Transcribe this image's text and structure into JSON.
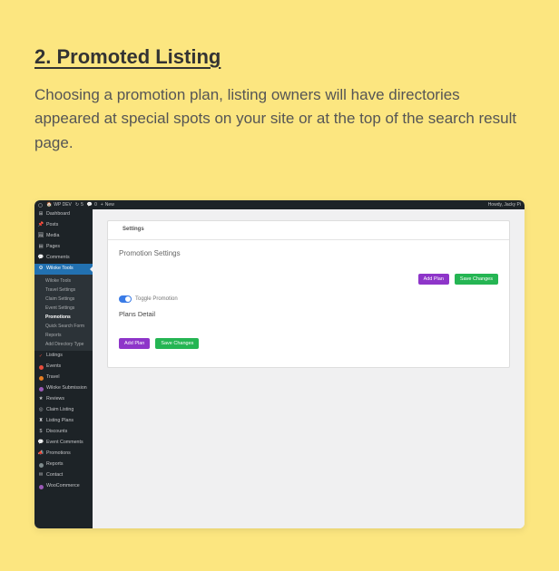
{
  "article": {
    "heading": "2. Promoted Listing",
    "description": "Choosing a promotion plan, listing owners will have directories appeared at special spots on your site or at the top of the search result page."
  },
  "wp": {
    "adminbar": {
      "site": "WP DEV",
      "updates": "5",
      "comments": "0",
      "new": "New",
      "greeting": "Howdy, Jacky Pi"
    },
    "menu": {
      "dashboard": "Dashboard",
      "posts": "Posts",
      "media": "Media",
      "pages": "Pages",
      "comments": "Comments",
      "wiloke_tools": "Wiloke Tools",
      "submenu": {
        "wiloke_tools": "Wiloke Tools",
        "travel_settings": "Travel Settings",
        "claim_settings": "Claim Settings",
        "event_settings": "Event Settings",
        "promotions": "Promotions",
        "quick_search": "Quick Search Form",
        "reports": "Reports",
        "add_directory": "Add Directory Type"
      },
      "listings": "Listings",
      "events": "Events",
      "travel": "Travel",
      "wiloke_submission": "Wiloke Submission",
      "reviews": "Reviews",
      "claim_listing": "Claim Listing",
      "listing_plans": "Listing Plans",
      "discounts": "Discounts",
      "event_comments": "Event Comments",
      "promotions2": "Promotions",
      "reports2": "Reports",
      "contact": "Contact",
      "woocommerce": "WooCommerce"
    },
    "content": {
      "tab": "Settings",
      "title": "Promotion Settings",
      "toggle_label": "Toggle Promotion",
      "plans_title": "Plans Detail",
      "btn_add": "Add Plan",
      "btn_save": "Save Changes"
    }
  }
}
